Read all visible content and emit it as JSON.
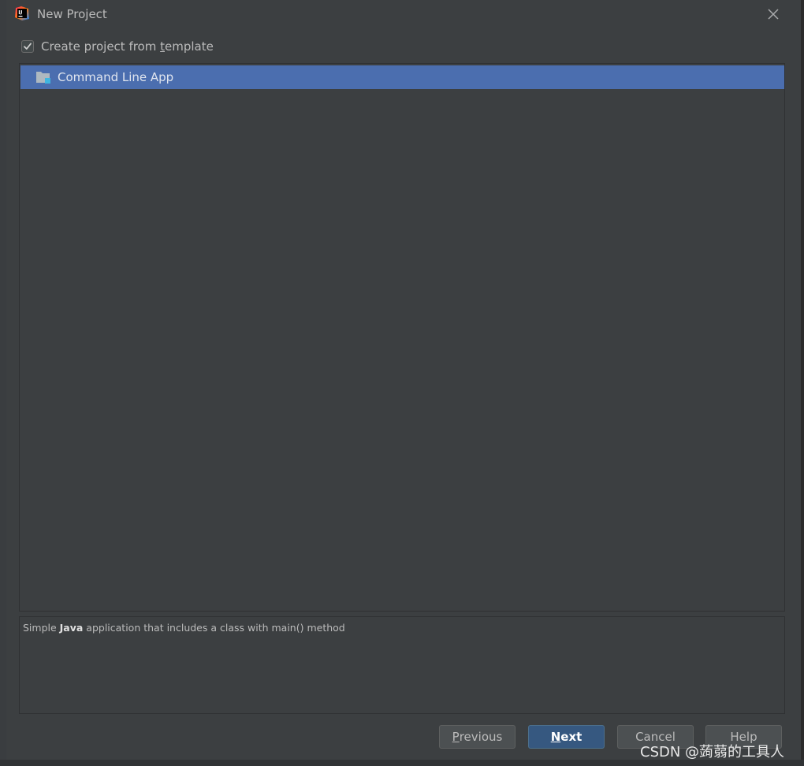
{
  "window": {
    "title": "New Project",
    "app_icon": "intellij-icon",
    "close_icon": "close-icon"
  },
  "template_option": {
    "label_before": "Create project from ",
    "label_mnemonic": "t",
    "label_after": "emplate",
    "checked": true
  },
  "template_list": {
    "items": [
      {
        "label": "Command Line App",
        "icon": "folder-icon",
        "selected": true
      }
    ]
  },
  "description": {
    "before": "Simple ",
    "bold": "Java",
    "after": " application that includes a class with main() method"
  },
  "buttons": {
    "previous_mnemonic": "P",
    "previous_rest": "revious",
    "next_mnemonic": "N",
    "next_rest": "ext",
    "cancel": "Cancel",
    "help": "Help"
  },
  "watermark": "CSDN @蒟蒻的工具人",
  "colors": {
    "dialog_bg": "#3c3f41",
    "selection": "#4b6eaf",
    "primary_button": "#365880"
  }
}
